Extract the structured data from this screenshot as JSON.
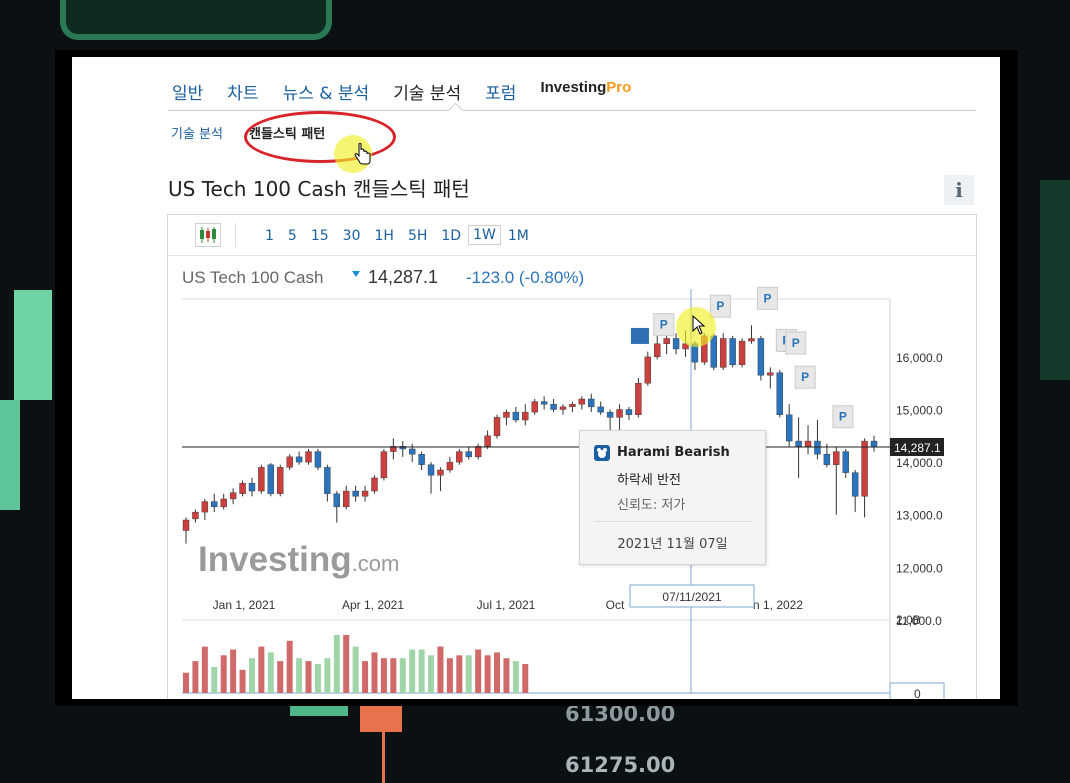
{
  "main_tabs": [
    "일반",
    "차트",
    "뉴스 & 분석",
    "기술 분석",
    "포럼"
  ],
  "pro_tab": {
    "brand": "Investing",
    "suffix": "Pro"
  },
  "sub_tabs": {
    "technical": "기술 분석",
    "candlestick": "캔들스틱 패턴"
  },
  "page_title": "US Tech 100 Cash 캔들스틱 패턴",
  "info_icon": "i",
  "toolbar": {
    "chart_type_icon": "candlestick-icon",
    "intervals": [
      "1",
      "5",
      "15",
      "30",
      "1H",
      "5H",
      "1D",
      "1W",
      "1M"
    ],
    "selected_interval": "1W"
  },
  "quote": {
    "name": "US Tech 100 Cash",
    "price": "14,287.1",
    "change": "-123.0",
    "change_pct": "(-0.80%)"
  },
  "tooltip": {
    "pattern": "Harami Bearish",
    "type": "하락세 반전",
    "reliability_label": "신뢰도: ",
    "reliability": "저가",
    "date": "2021년 11월 07일"
  },
  "watermark": {
    "brand": "Investing",
    "suffix": ".com"
  },
  "pattern_marker": "P",
  "colors": {
    "up": "#c9403e",
    "down": "#2b74bb",
    "volume": "#9fd5a8",
    "volume_red": "#d06a6a",
    "link": "#1a5fa0"
  },
  "chart_data": {
    "type": "candlestick",
    "title": "US Tech 100 Cash",
    "last_price": 14287.1,
    "last_price_label": "14,287.1",
    "y_ticks": [
      "16,000.0",
      "15,000.0",
      "14,000.0",
      "13,000.0",
      "12,000.0",
      "11,000.0"
    ],
    "y_tick_values": [
      16000,
      15000,
      14000,
      13000,
      12000,
      11000
    ],
    "ylim": [
      10600,
      17100
    ],
    "x_ticks": [
      "Jan 1, 2021",
      "Apr 1, 2021",
      "Jul 1, 2021",
      "Oct",
      "n 1, 2022"
    ],
    "crosshair_label": "07/11/2021",
    "volume_axis": {
      "top_label": "2.0B",
      "bottom_label": "0"
    },
    "candles": [
      {
        "o": 12700,
        "h": 12950,
        "l": 12450,
        "c": 12900
      },
      {
        "o": 12920,
        "h": 13100,
        "l": 12850,
        "c": 13050
      },
      {
        "o": 13050,
        "h": 13300,
        "l": 12900,
        "c": 13250
      },
      {
        "o": 13250,
        "h": 13400,
        "l": 13050,
        "c": 13150
      },
      {
        "o": 13150,
        "h": 13400,
        "l": 13100,
        "c": 13300
      },
      {
        "o": 13300,
        "h": 13500,
        "l": 13200,
        "c": 13420
      },
      {
        "o": 13400,
        "h": 13650,
        "l": 13350,
        "c": 13600
      },
      {
        "o": 13600,
        "h": 13700,
        "l": 13350,
        "c": 13450
      },
      {
        "o": 13450,
        "h": 13950,
        "l": 13400,
        "c": 13900
      },
      {
        "o": 13950,
        "h": 13980,
        "l": 13350,
        "c": 13400
      },
      {
        "o": 13400,
        "h": 13950,
        "l": 13350,
        "c": 13900
      },
      {
        "o": 13900,
        "h": 14150,
        "l": 13850,
        "c": 14100
      },
      {
        "o": 14100,
        "h": 14200,
        "l": 13950,
        "c": 14000
      },
      {
        "o": 14000,
        "h": 14250,
        "l": 13950,
        "c": 14200
      },
      {
        "o": 14200,
        "h": 14250,
        "l": 13850,
        "c": 13900
      },
      {
        "o": 13900,
        "h": 13950,
        "l": 13250,
        "c": 13400
      },
      {
        "o": 13400,
        "h": 13450,
        "l": 12850,
        "c": 13150
      },
      {
        "o": 13150,
        "h": 13550,
        "l": 13100,
        "c": 13450
      },
      {
        "o": 13450,
        "h": 13550,
        "l": 13250,
        "c": 13350
      },
      {
        "o": 13350,
        "h": 13550,
        "l": 13250,
        "c": 13450
      },
      {
        "o": 13450,
        "h": 13750,
        "l": 13400,
        "c": 13700
      },
      {
        "o": 13700,
        "h": 14250,
        "l": 13650,
        "c": 14200
      },
      {
        "o": 14200,
        "h": 14450,
        "l": 14050,
        "c": 14300
      },
      {
        "o": 14300,
        "h": 14400,
        "l": 14100,
        "c": 14250
      },
      {
        "o": 14250,
        "h": 14350,
        "l": 14000,
        "c": 14150
      },
      {
        "o": 14150,
        "h": 14200,
        "l": 13850,
        "c": 13950
      },
      {
        "o": 13950,
        "h": 14000,
        "l": 13400,
        "c": 13750
      },
      {
        "o": 13750,
        "h": 13900,
        "l": 13450,
        "c": 13850
      },
      {
        "o": 13850,
        "h": 14100,
        "l": 13800,
        "c": 14000
      },
      {
        "o": 14000,
        "h": 14250,
        "l": 13950,
        "c": 14200
      },
      {
        "o": 14200,
        "h": 14300,
        "l": 14050,
        "c": 14100
      },
      {
        "o": 14100,
        "h": 14350,
        "l": 14050,
        "c": 14300
      },
      {
        "o": 14300,
        "h": 14600,
        "l": 14250,
        "c": 14500
      },
      {
        "o": 14500,
        "h": 14900,
        "l": 14450,
        "c": 14850
      },
      {
        "o": 14850,
        "h": 15000,
        "l": 14700,
        "c": 14950
      },
      {
        "o": 14950,
        "h": 15050,
        "l": 14750,
        "c": 14800
      },
      {
        "o": 14800,
        "h": 15100,
        "l": 14700,
        "c": 14950
      },
      {
        "o": 14950,
        "h": 15200,
        "l": 14900,
        "c": 15150
      },
      {
        "o": 15150,
        "h": 15250,
        "l": 15000,
        "c": 15100
      },
      {
        "o": 15100,
        "h": 15200,
        "l": 14950,
        "c": 15000
      },
      {
        "o": 15000,
        "h": 15100,
        "l": 14900,
        "c": 15050
      },
      {
        "o": 15050,
        "h": 15150,
        "l": 14950,
        "c": 15100
      },
      {
        "o": 15100,
        "h": 15250,
        "l": 15000,
        "c": 15200
      },
      {
        "o": 15200,
        "h": 15300,
        "l": 14950,
        "c": 15050
      },
      {
        "o": 15050,
        "h": 15150,
        "l": 14900,
        "c": 14950
      },
      {
        "o": 14950,
        "h": 15000,
        "l": 14350,
        "c": 14850
      },
      {
        "o": 14850,
        "h": 15100,
        "l": 14350,
        "c": 15000
      },
      {
        "o": 15000,
        "h": 15050,
        "l": 14800,
        "c": 14900
      },
      {
        "o": 14900,
        "h": 15600,
        "l": 14850,
        "c": 15500
      },
      {
        "o": 15500,
        "h": 16100,
        "l": 15450,
        "c": 16000
      },
      {
        "o": 16000,
        "h": 16400,
        "l": 15950,
        "c": 16250
      },
      {
        "o": 16250,
        "h": 16550,
        "l": 16050,
        "c": 16350
      },
      {
        "o": 16350,
        "h": 16450,
        "l": 16050,
        "c": 16150
      },
      {
        "o": 16150,
        "h": 16500,
        "l": 16000,
        "c": 16250
      },
      {
        "o": 16250,
        "h": 16300,
        "l": 15750,
        "c": 15900
      },
      {
        "o": 15900,
        "h": 16450,
        "l": 15850,
        "c": 16400
      },
      {
        "o": 16400,
        "h": 16450,
        "l": 15750,
        "c": 15800
      },
      {
        "o": 15800,
        "h": 16450,
        "l": 15750,
        "c": 16350
      },
      {
        "o": 16350,
        "h": 16400,
        "l": 15800,
        "c": 15850
      },
      {
        "o": 15850,
        "h": 16350,
        "l": 15800,
        "c": 16300
      },
      {
        "o": 16300,
        "h": 16600,
        "l": 16250,
        "c": 16350
      },
      {
        "o": 16350,
        "h": 16400,
        "l": 15550,
        "c": 15650
      },
      {
        "o": 15650,
        "h": 15800,
        "l": 15400,
        "c": 15700
      },
      {
        "o": 15700,
        "h": 15750,
        "l": 14850,
        "c": 14900
      },
      {
        "o": 14900,
        "h": 15100,
        "l": 14300,
        "c": 14400
      },
      {
        "o": 14400,
        "h": 14850,
        "l": 13700,
        "c": 14300
      },
      {
        "o": 14300,
        "h": 14700,
        "l": 14150,
        "c": 14400
      },
      {
        "o": 14400,
        "h": 14800,
        "l": 14050,
        "c": 14150
      },
      {
        "o": 14150,
        "h": 14350,
        "l": 13900,
        "c": 13950
      },
      {
        "o": 13950,
        "h": 14300,
        "l": 13000,
        "c": 14200
      },
      {
        "o": 14200,
        "h": 14250,
        "l": 13700,
        "c": 13800
      },
      {
        "o": 13800,
        "h": 13850,
        "l": 13050,
        "c": 13350
      },
      {
        "o": 13350,
        "h": 14450,
        "l": 12950,
        "c": 14400
      },
      {
        "o": 14400,
        "h": 14500,
        "l": 14200,
        "c": 14287
      }
    ],
    "volumes": [
      0.35,
      0.55,
      0.8,
      0.45,
      0.65,
      0.75,
      0.4,
      0.6,
      0.8,
      0.7,
      0.55,
      0.9,
      0.6,
      0.55,
      0.5,
      0.6,
      1.0,
      1.0,
      0.8,
      0.55,
      0.7,
      0.6,
      0.6,
      0.6,
      0.75,
      0.75,
      0.65,
      0.8,
      0.6,
      0.65,
      0.65,
      0.75,
      0.65,
      0.7,
      0.6,
      0.55,
      0.5
    ],
    "pattern_markers_at": [
      49,
      55,
      60,
      62,
      63,
      64,
      68
    ]
  }
}
